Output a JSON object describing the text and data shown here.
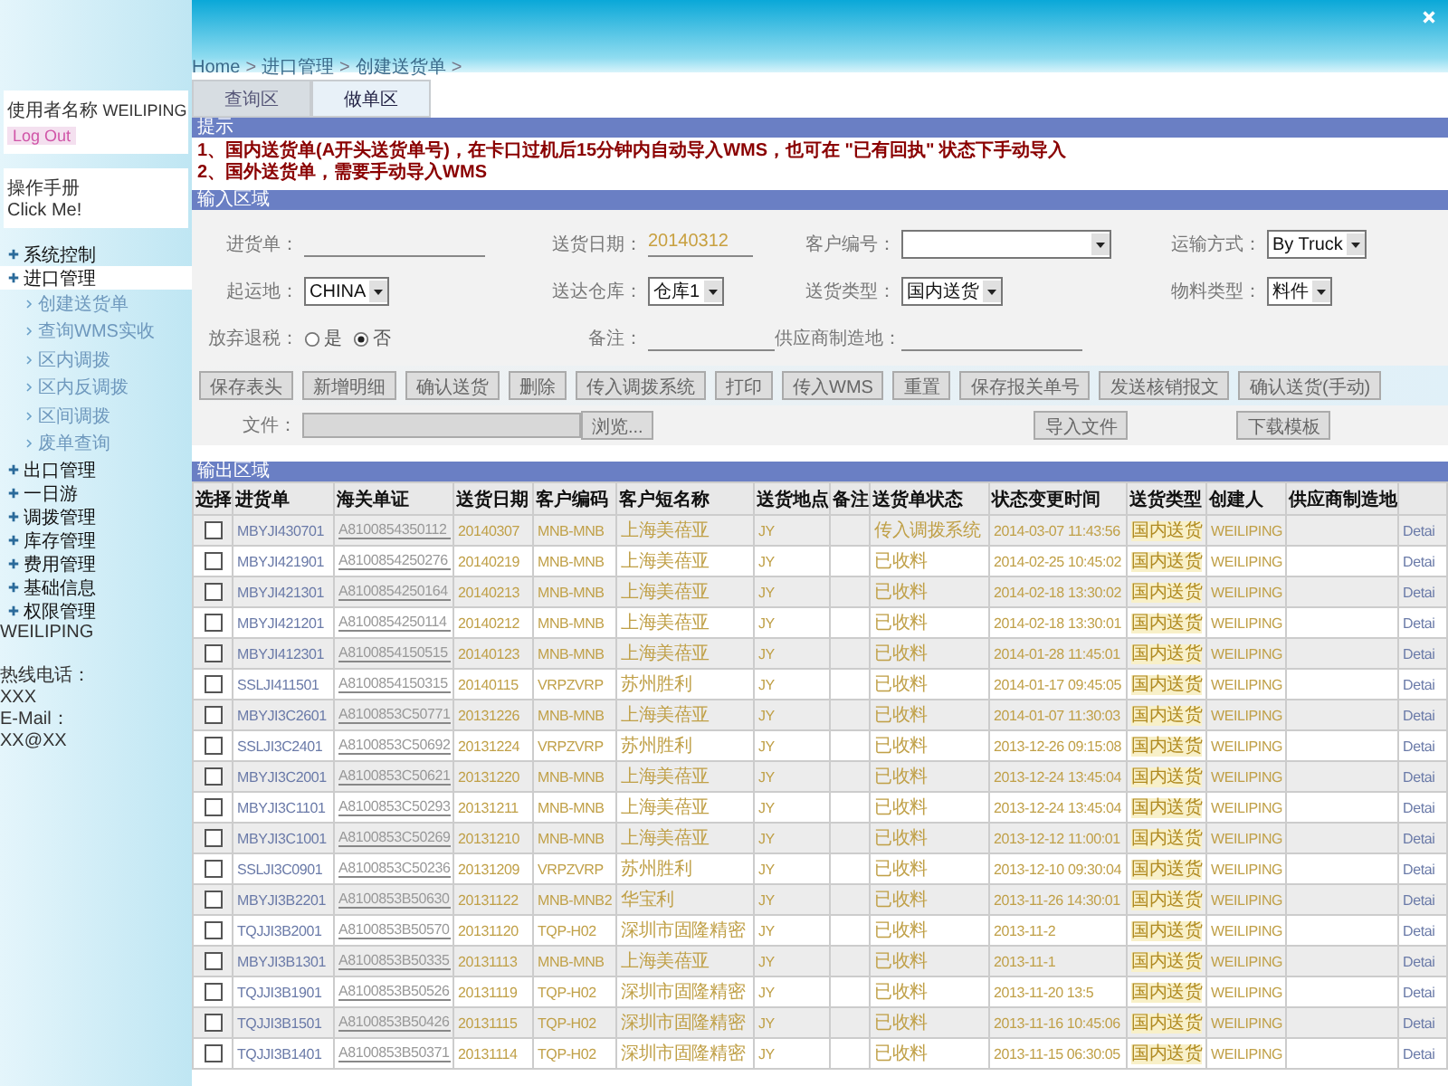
{
  "breadcrumb": {
    "items": [
      "Home",
      "进口管理",
      "创建送货单"
    ],
    "separator": ">"
  },
  "sidebar": {
    "user": {
      "label": "使用者名称",
      "name": "WEILIPING",
      "logout": "Log Out"
    },
    "manual": {
      "title": "操作手册",
      "link": "Click Me!"
    },
    "menu": [
      {
        "label": "系统控制",
        "selected": false
      },
      {
        "label": "进口管理",
        "selected": true,
        "children": [
          {
            "label": "创建送货单"
          },
          {
            "label": "查询WMS实收"
          },
          {
            "label": "区内调拨"
          },
          {
            "label": "区内反调拨"
          },
          {
            "label": "区间调拨"
          },
          {
            "label": "废单查询"
          }
        ]
      },
      {
        "label": "出口管理",
        "selected": false
      },
      {
        "label": "一日游",
        "selected": false
      },
      {
        "label": "调拨管理",
        "selected": false
      },
      {
        "label": "库存管理",
        "selected": false
      },
      {
        "label": "费用管理",
        "selected": false
      },
      {
        "label": "基础信息",
        "selected": false
      },
      {
        "label": "权限管理",
        "selected": false
      }
    ],
    "footer": {
      "user": "WEILIPING",
      "hotline_label": "热线电话：",
      "hotline": "XXX",
      "email_label": "E-Mail：",
      "email": "XX@XX"
    }
  },
  "tabs": [
    {
      "label": "查询区",
      "selected": false
    },
    {
      "label": "做单区",
      "selected": true
    }
  ],
  "notice": {
    "title": "提示",
    "lines": [
      "1、国内送货单(A开头送货单号)，在卡口过机后15分钟内自动导入WMS，也可在 \"已有回执\" 状态下手动导入",
      "2、国外送货单，需要手动导入WMS"
    ]
  },
  "input_section": {
    "title": "输入区域",
    "fields": [
      {
        "kind": "line",
        "label": "进货单："
      },
      {
        "kind": "input",
        "label": "送货日期：",
        "value": "20140312"
      },
      {
        "kind": "select",
        "label": "客户编号："
      },
      {
        "kind": "select",
        "label": "运输方式：",
        "value": "By Truck"
      },
      {
        "kind": "select",
        "label": "起运地：",
        "value": "CHINA"
      },
      {
        "kind": "select",
        "label": "送达仓库：",
        "value": "仓库1"
      },
      {
        "kind": "select",
        "label": "送货类型：",
        "value": "国内送货"
      },
      {
        "kind": "select",
        "label": "物料类型：",
        "value": "料件"
      },
      {
        "kind": "radio",
        "label": "放弃退税：",
        "options": [
          {
            "label": "是",
            "selected": false
          },
          {
            "label": "否",
            "selected": true
          }
        ]
      },
      {
        "kind": "line",
        "label": "备注："
      },
      {
        "kind": "line",
        "label": "供应商制造地："
      }
    ],
    "buttons": [
      "保存表头",
      "新增明细",
      "确认送货",
      "删除",
      "传入调拨系统",
      "打印",
      "传入WMS",
      "重置",
      "保存报关单号",
      "发送核销报文",
      "确认送货(手动)"
    ],
    "file": {
      "label": "文件：",
      "browse": "浏览...",
      "import": "导入文件",
      "template": "下载模板"
    }
  },
  "output_section": {
    "title": "输出区域",
    "table": {
      "columns": [
        "选择",
        "进货单",
        "海关单证",
        "送货日期",
        "客户编码",
        "客户短名称",
        "送货地点",
        "备注",
        "送货单状态",
        "状态变更时间",
        "送货类型",
        "创建人",
        "供应商制造地"
      ],
      "rows": [
        {
          "checked": false,
          "order": "MBYJI430701",
          "customs_doc": "A8100854350112",
          "date": "20140307",
          "customer_code": "MNB-MNB",
          "customer_name": "上海美蓓亚",
          "point": "JY",
          "status": "传入调拨系统",
          "status_time": "2014-03-07 11:43:56",
          "delivery_type": "国内送货",
          "creator": "WEILIPING",
          "link": "Detai"
        },
        {
          "checked": false,
          "order": "MBYJI421901",
          "customs_doc": "A8100854250276",
          "date": "20140219",
          "customer_code": "MNB-MNB",
          "customer_name": "上海美蓓亚",
          "point": "JY",
          "status": "已收料",
          "status_time": "2014-02-25 10:45:02",
          "delivery_type": "国内送货",
          "creator": "WEILIPING",
          "link": "Detai"
        },
        {
          "checked": false,
          "order": "MBYJI421301",
          "customs_doc": "A8100854250164",
          "date": "20140213",
          "customer_code": "MNB-MNB",
          "customer_name": "上海美蓓亚",
          "point": "JY",
          "status": "已收料",
          "status_time": "2014-02-18 13:30:02",
          "delivery_type": "国内送货",
          "creator": "WEILIPING",
          "link": "Detai"
        },
        {
          "checked": false,
          "order": "MBYJI421201",
          "customs_doc": "A8100854250114",
          "date": "20140212",
          "customer_code": "MNB-MNB",
          "customer_name": "上海美蓓亚",
          "point": "JY",
          "status": "已收料",
          "status_time": "2014-02-18 13:30:01",
          "delivery_type": "国内送货",
          "creator": "WEILIPING",
          "link": "Detai"
        },
        {
          "checked": false,
          "order": "MBYJI412301",
          "customs_doc": "A8100854150515",
          "date": "20140123",
          "customer_code": "MNB-MNB",
          "customer_name": "上海美蓓亚",
          "point": "JY",
          "status": "已收料",
          "status_time": "2014-01-28 11:45:01",
          "delivery_type": "国内送货",
          "creator": "WEILIPING",
          "link": "Detai"
        },
        {
          "checked": false,
          "order": "SSLJI411501",
          "customs_doc": "A8100854150315",
          "date": "20140115",
          "customer_code": "VRPZVRP",
          "customer_name": "苏州胜利",
          "point": "JY",
          "status": "已收料",
          "status_time": "2014-01-17 09:45:05",
          "delivery_type": "国内送货",
          "creator": "WEILIPING",
          "link": "Detai"
        },
        {
          "checked": false,
          "order": "MBYJI3C2601",
          "customs_doc": "A8100853C50771",
          "date": "20131226",
          "customer_code": "MNB-MNB",
          "customer_name": "上海美蓓亚",
          "point": "JY",
          "status": "已收料",
          "status_time": "2014-01-07 11:30:03",
          "delivery_type": "国内送货",
          "creator": "WEILIPING",
          "link": "Detai"
        },
        {
          "checked": false,
          "order": "SSLJI3C2401",
          "customs_doc": "A8100853C50692",
          "date": "20131224",
          "customer_code": "VRPZVRP",
          "customer_name": "苏州胜利",
          "point": "JY",
          "status": "已收料",
          "status_time": "2013-12-26 09:15:08",
          "delivery_type": "国内送货",
          "creator": "WEILIPING",
          "link": "Detai"
        },
        {
          "checked": false,
          "order": "MBYJI3C2001",
          "customs_doc": "A8100853C50621",
          "date": "20131220",
          "customer_code": "MNB-MNB",
          "customer_name": "上海美蓓亚",
          "point": "JY",
          "status": "已收料",
          "status_time": "2013-12-24 13:45:04",
          "delivery_type": "国内送货",
          "creator": "WEILIPING",
          "link": "Detai"
        },
        {
          "checked": false,
          "order": "MBYJI3C1101",
          "customs_doc": "A8100853C50293",
          "date": "20131211",
          "customer_code": "MNB-MNB",
          "customer_name": "上海美蓓亚",
          "point": "JY",
          "status": "已收料",
          "status_time": "2013-12-24 13:45:04",
          "delivery_type": "国内送货",
          "creator": "WEILIPING",
          "link": "Detai"
        },
        {
          "checked": false,
          "order": "MBYJI3C1001",
          "customs_doc": "A8100853C50269",
          "date": "20131210",
          "customer_code": "MNB-MNB",
          "customer_name": "上海美蓓亚",
          "point": "JY",
          "status": "已收料",
          "status_time": "2013-12-12 11:00:01",
          "delivery_type": "国内送货",
          "creator": "WEILIPING",
          "link": "Detai"
        },
        {
          "checked": false,
          "order": "SSLJI3C0901",
          "customs_doc": "A8100853C50236",
          "date": "20131209",
          "customer_code": "VRPZVRP",
          "customer_name": "苏州胜利",
          "point": "JY",
          "status": "已收料",
          "status_time": "2013-12-10 09:30:04",
          "delivery_type": "国内送货",
          "creator": "WEILIPING",
          "link": "Detai"
        },
        {
          "checked": false,
          "order": "MBYJI3B2201",
          "customs_doc": "A8100853B50630",
          "date": "20131122",
          "customer_code": "MNB-MNB2",
          "customer_name": "华宝利",
          "point": "JY",
          "status": "已收料",
          "status_time": "2013-11-26 14:30:01",
          "delivery_type": "国内送货",
          "creator": "WEILIPING",
          "link": "Detai"
        },
        {
          "checked": false,
          "order": "TQJJI3B2001",
          "customs_doc": "A8100853B50570",
          "date": "20131120",
          "customer_code": "TQP-H02",
          "customer_name": "深圳市固隆精密",
          "point": "JY",
          "status": "已收料",
          "status_time": "2013-11-2",
          "delivery_type": "国内送货",
          "creator": "WEILIPING",
          "link": "Detai"
        },
        {
          "checked": false,
          "order": "MBYJI3B1301",
          "customs_doc": "A8100853B50335",
          "date": "20131113",
          "customer_code": "MNB-MNB",
          "customer_name": "上海美蓓亚",
          "point": "JY",
          "status": "已收料",
          "status_time": "2013-11-1",
          "delivery_type": "国内送货",
          "creator": "WEILIPING",
          "link": "Detai"
        },
        {
          "checked": false,
          "order": "TQJJI3B1901",
          "customs_doc": "A8100853B50526",
          "date": "20131119",
          "customer_code": "TQP-H02",
          "customer_name": "深圳市固隆精密",
          "point": "JY",
          "status": "已收料",
          "status_time": "2013-11-20 13:5",
          "delivery_type": "国内送货",
          "creator": "WEILIPING",
          "link": "Detai"
        },
        {
          "checked": false,
          "order": "TQJJI3B1501",
          "customs_doc": "A8100853B50426",
          "date": "20131115",
          "customer_code": "TQP-H02",
          "customer_name": "深圳市固隆精密",
          "point": "JY",
          "status": "已收料",
          "status_time": "2013-11-16 10:45:06",
          "delivery_type": "国内送货",
          "creator": "WEILIPING",
          "link": "Detai"
        },
        {
          "checked": false,
          "order": "TQJJI3B1401",
          "customs_doc": "A8100853B50371",
          "date": "20131114",
          "customer_code": "TQP-H02",
          "customer_name": "深圳市固隆精密",
          "point": "JY",
          "status": "已收料",
          "status_time": "2013-11-15 06:30:05",
          "delivery_type": "国内送货",
          "creator": "WEILIPING",
          "link": "Detai"
        }
      ]
    }
  }
}
